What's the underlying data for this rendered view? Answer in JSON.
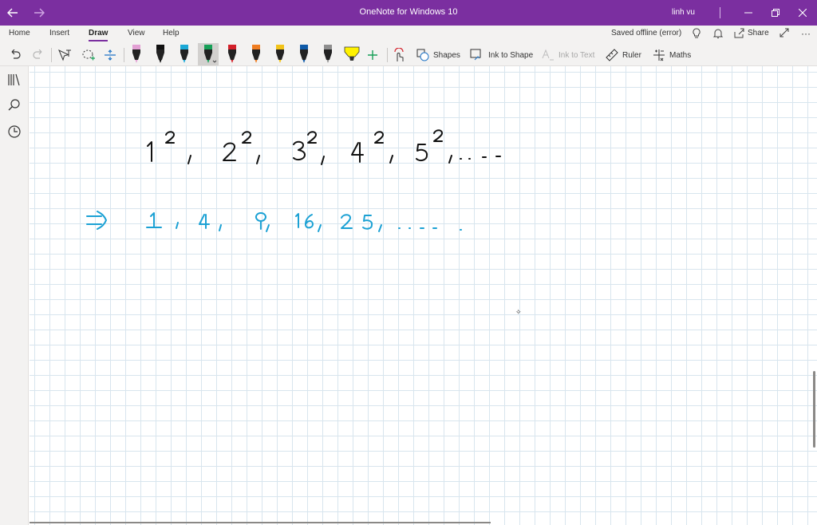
{
  "window": {
    "title": "OneNote for Windows 10",
    "user": "linh vu"
  },
  "tabs": [
    {
      "label": "Home"
    },
    {
      "label": "Insert"
    },
    {
      "label": "Draw"
    },
    {
      "label": "View"
    },
    {
      "label": "Help"
    }
  ],
  "status": {
    "saved": "Saved offline (error)",
    "share": "Share"
  },
  "toolbar": {
    "shapes": "Shapes",
    "ink_to_shape": "Ink to Shape",
    "ink_to_text": "Ink to Text",
    "ruler": "Ruler",
    "maths": "Maths"
  },
  "pens": [
    {
      "name": "pink-pen",
      "color": "#e3a0d4"
    },
    {
      "name": "black-pen",
      "color": "#111111"
    },
    {
      "name": "cyan-pen",
      "color": "#1ba8d6"
    },
    {
      "name": "green-pen",
      "color": "#18a058"
    },
    {
      "name": "red-pen",
      "color": "#d3202a"
    },
    {
      "name": "orange-pen",
      "color": "#ef7d22"
    },
    {
      "name": "yellow-pen",
      "color": "#f2c318"
    },
    {
      "name": "blue-pen",
      "color": "#0f5aa8"
    },
    {
      "name": "galaxy-pen",
      "color": "#8e8e8e"
    },
    {
      "name": "highlighter",
      "color": "#fff200"
    }
  ],
  "ink": {
    "line1_text": "1², 2², 3², 4², 5², ....",
    "line1_color": "#111111",
    "line2_text": "⇒ 1, 4, 9, 16, 25, .... .",
    "line2_color": "#1ba1d4"
  }
}
